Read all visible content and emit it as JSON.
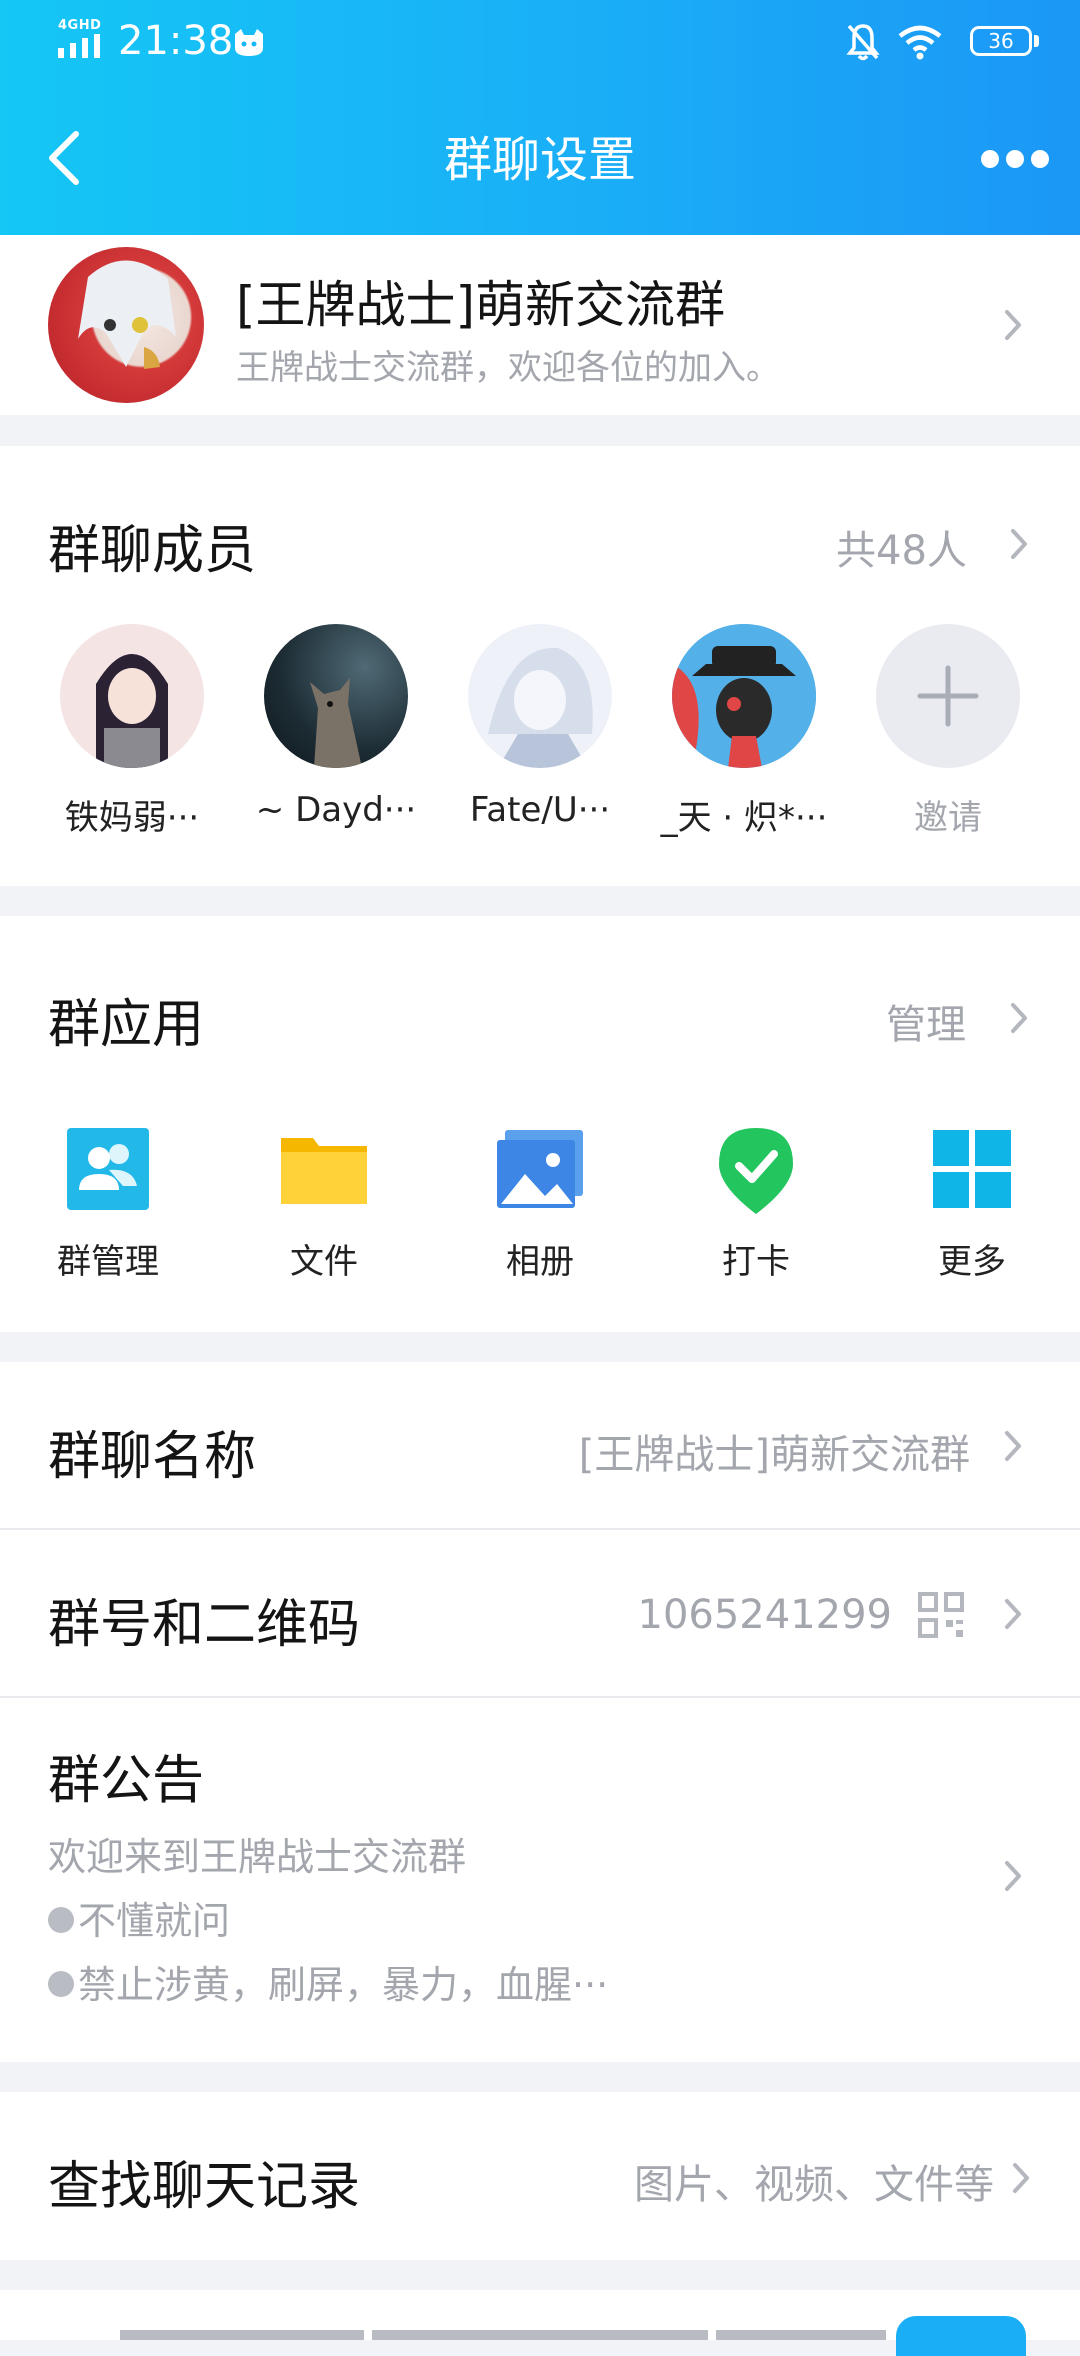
{
  "status_bar": {
    "network": "4GHD",
    "time": "21:38",
    "battery": "36"
  },
  "nav": {
    "title": "群聊设置"
  },
  "group": {
    "name": "[王牌战士]萌新交流群",
    "description": "王牌战士交流群，欢迎各位的加入。"
  },
  "members": {
    "title": "群聊成员",
    "count": "共48人",
    "list": [
      {
        "name": "铁妈弱···",
        "color": "#f3dede"
      },
      {
        "name": "~ Dayd···",
        "color": "#1c2b33"
      },
      {
        "name": "Fate/U···",
        "color": "#dfe6f0"
      },
      {
        "name": "_天 · 炽*···",
        "color": "#3a8fd6"
      }
    ],
    "invite_label": "邀请"
  },
  "apps": {
    "title": "群应用",
    "manage": "管理",
    "items": [
      {
        "label": "群管理",
        "icon": "group-manage-icon"
      },
      {
        "label": "文件",
        "icon": "folder-icon"
      },
      {
        "label": "相册",
        "icon": "album-icon"
      },
      {
        "label": "打卡",
        "icon": "checkin-icon"
      },
      {
        "label": "更多",
        "icon": "more-apps-icon"
      }
    ]
  },
  "info": {
    "name_label": "群聊名称",
    "name_value": "[王牌战士]萌新交流群",
    "number_label": "群号和二维码",
    "number_value": "1065241299"
  },
  "notice": {
    "title": "群公告",
    "line1": "欢迎来到王牌战士交流群",
    "line2": "不懂就问",
    "line3": "禁止涉黄，刷屏，暴力，血腥···"
  },
  "history": {
    "label": "查找聊天记录",
    "hint": "图片、视频、文件等"
  },
  "colors": {
    "accent": "#1aaef7",
    "muted_text": "#a3a6ad",
    "checkin_green": "#22c55e",
    "folder_yellow": "#ffc107"
  }
}
